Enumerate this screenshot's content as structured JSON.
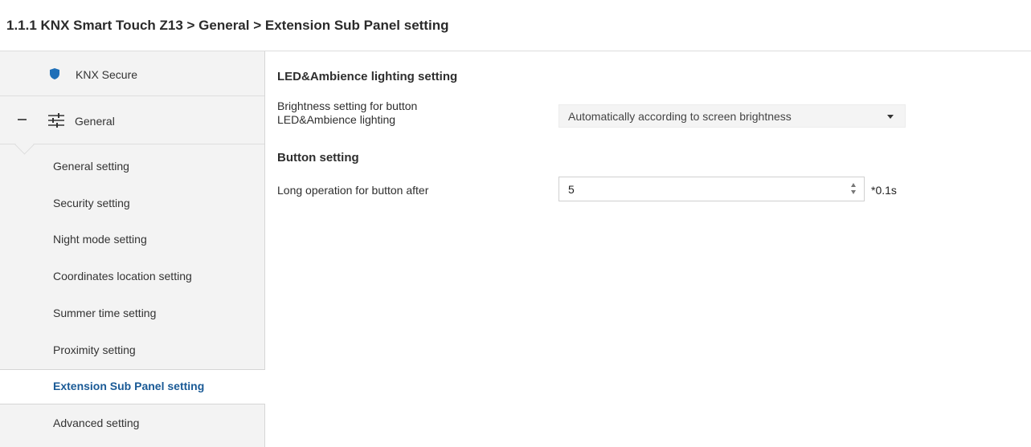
{
  "header": {
    "title": "1.1.1 KNX Smart Touch Z13 > General > Extension Sub Panel setting"
  },
  "sidebar": {
    "knx_secure": {
      "label": "KNX Secure",
      "icon": "shield-icon"
    },
    "general": {
      "label": "General",
      "icon": "sliders-icon",
      "expanded": true
    },
    "items": [
      {
        "label": "General setting"
      },
      {
        "label": "Security setting"
      },
      {
        "label": "Night mode setting"
      },
      {
        "label": "Coordinates location setting"
      },
      {
        "label": "Summer time setting"
      },
      {
        "label": "Proximity setting"
      },
      {
        "label": "Extension Sub Panel setting",
        "active": true
      },
      {
        "label": "Advanced setting"
      }
    ]
  },
  "main": {
    "led_section": {
      "title": "LED&Ambience lighting setting",
      "brightness": {
        "label_line1": "Brightness setting for button",
        "label_line2": "LED&Ambience lighting",
        "value": "Automatically according to screen brightness"
      }
    },
    "button_section": {
      "title": "Button setting",
      "long_operation": {
        "label": "Long operation for button after",
        "value": "5",
        "unit": "*0.1s"
      }
    }
  },
  "colors": {
    "sidebar_bg": "#f3f3f3",
    "active_text": "#1a5a96",
    "shield": "#1e6fb8"
  }
}
